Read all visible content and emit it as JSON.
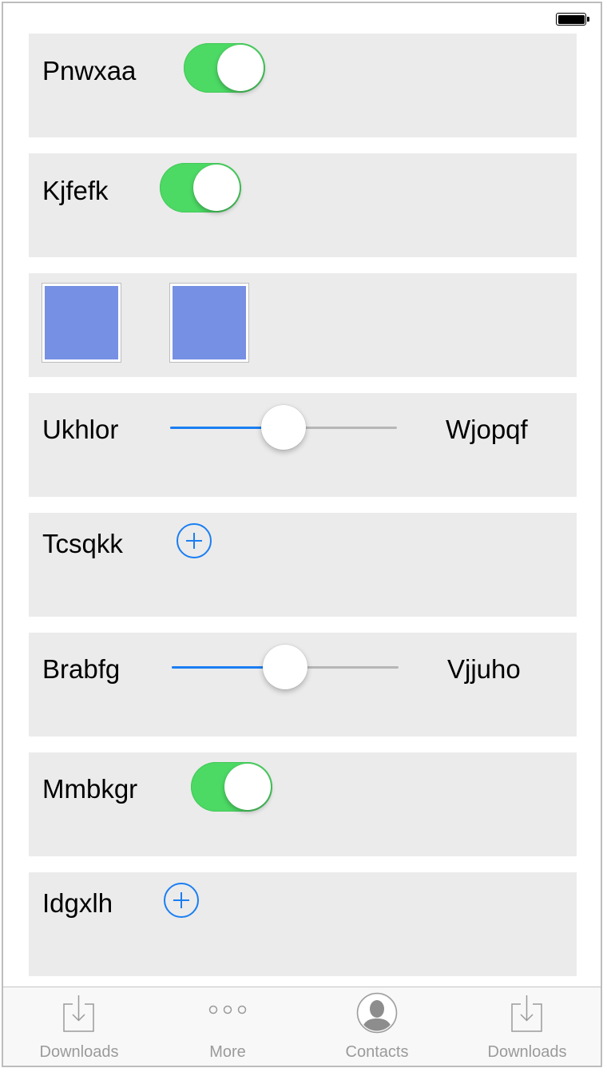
{
  "status_bar": {
    "battery_icon": "battery-full-icon"
  },
  "rows": [
    {
      "type": "toggle",
      "label": "Pnwxaa",
      "on": true
    },
    {
      "type": "toggle",
      "label": "Kjfefk",
      "on": true
    },
    {
      "type": "swatches",
      "colors": [
        "#7690e3",
        "#7690e3"
      ]
    },
    {
      "type": "slider",
      "label_left": "Ukhlor",
      "label_right": "Wjopqf",
      "value": 0.5
    },
    {
      "type": "add",
      "label": "Tcsqkk",
      "icon": "plus-circle-icon"
    },
    {
      "type": "slider",
      "label_left": "Brabfg",
      "label_right": "Vjjuho",
      "value": 0.5
    },
    {
      "type": "toggle",
      "label": "Mmbkgr",
      "on": true
    },
    {
      "type": "add",
      "label": "Idgxlh",
      "icon": "plus-circle-icon"
    }
  ],
  "tab_bar": {
    "items": [
      {
        "label": "Downloads",
        "icon": "downloads-icon"
      },
      {
        "label": "More",
        "icon": "more-icon"
      },
      {
        "label": "Contacts",
        "icon": "contacts-icon"
      },
      {
        "label": "Downloads",
        "icon": "downloads-icon"
      }
    ]
  },
  "colors": {
    "toggle_on": "#4cd964",
    "accent": "#1a7ef2",
    "row_background": "#ebebeb",
    "swatch": "#7690e3",
    "tab_label": "#9a9a9a"
  }
}
